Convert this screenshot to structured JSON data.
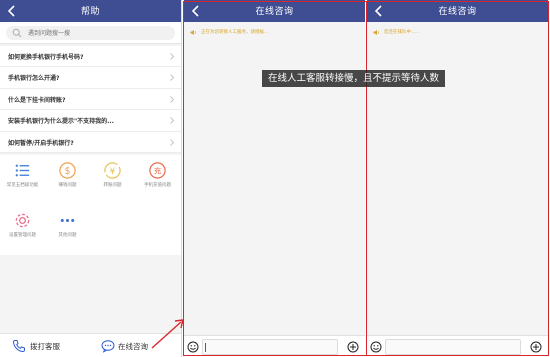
{
  "colors": {
    "nav_bg": "#3f4d93",
    "accent_blue": "#2e5bd6",
    "notice_yellow": "#d9a42c",
    "annotation_red": "#d9262c"
  },
  "help": {
    "title": "帮助",
    "back_icon": "chevron-left-icon",
    "search_placeholder": "遇到问题搜一搜",
    "faq": [
      "如何更换手机银行手机号码?",
      "手机银行怎么开通?",
      "什么是下挂卡间转账?",
      "安装手机银行为什么提示\"不支持我的...",
      "如何暂停/开启手机银行?"
    ],
    "grid": [
      {
        "label": "常见五档级功能",
        "icon": "list-icon",
        "color": "#3f7fd8"
      },
      {
        "label": "赚钱问题",
        "icon": "dollar-icon",
        "color": "#f0a24b"
      },
      {
        "label": "转账问题",
        "icon": "yen-transfer-icon",
        "color": "#e8c15a"
      },
      {
        "label": "手机充值问题",
        "icon": "recharge-icon",
        "color": "#e86b4f"
      },
      {
        "label": "设置管理问题",
        "icon": "gear-icon",
        "color": "#e86b8a"
      },
      {
        "label": "其他问题",
        "icon": "more-dots-icon",
        "color": "#3f6fd8"
      }
    ],
    "call_label": "拨打客服",
    "chat_label": "在线咨询"
  },
  "chat1": {
    "title": "在线咨询",
    "notice": "正在为您转接人工服务，请稍候..."
  },
  "chat2": {
    "title": "在线咨询",
    "notice": "您还在排队中......"
  },
  "annotation": "在线人工客服转接慢，且不提示等待人数"
}
